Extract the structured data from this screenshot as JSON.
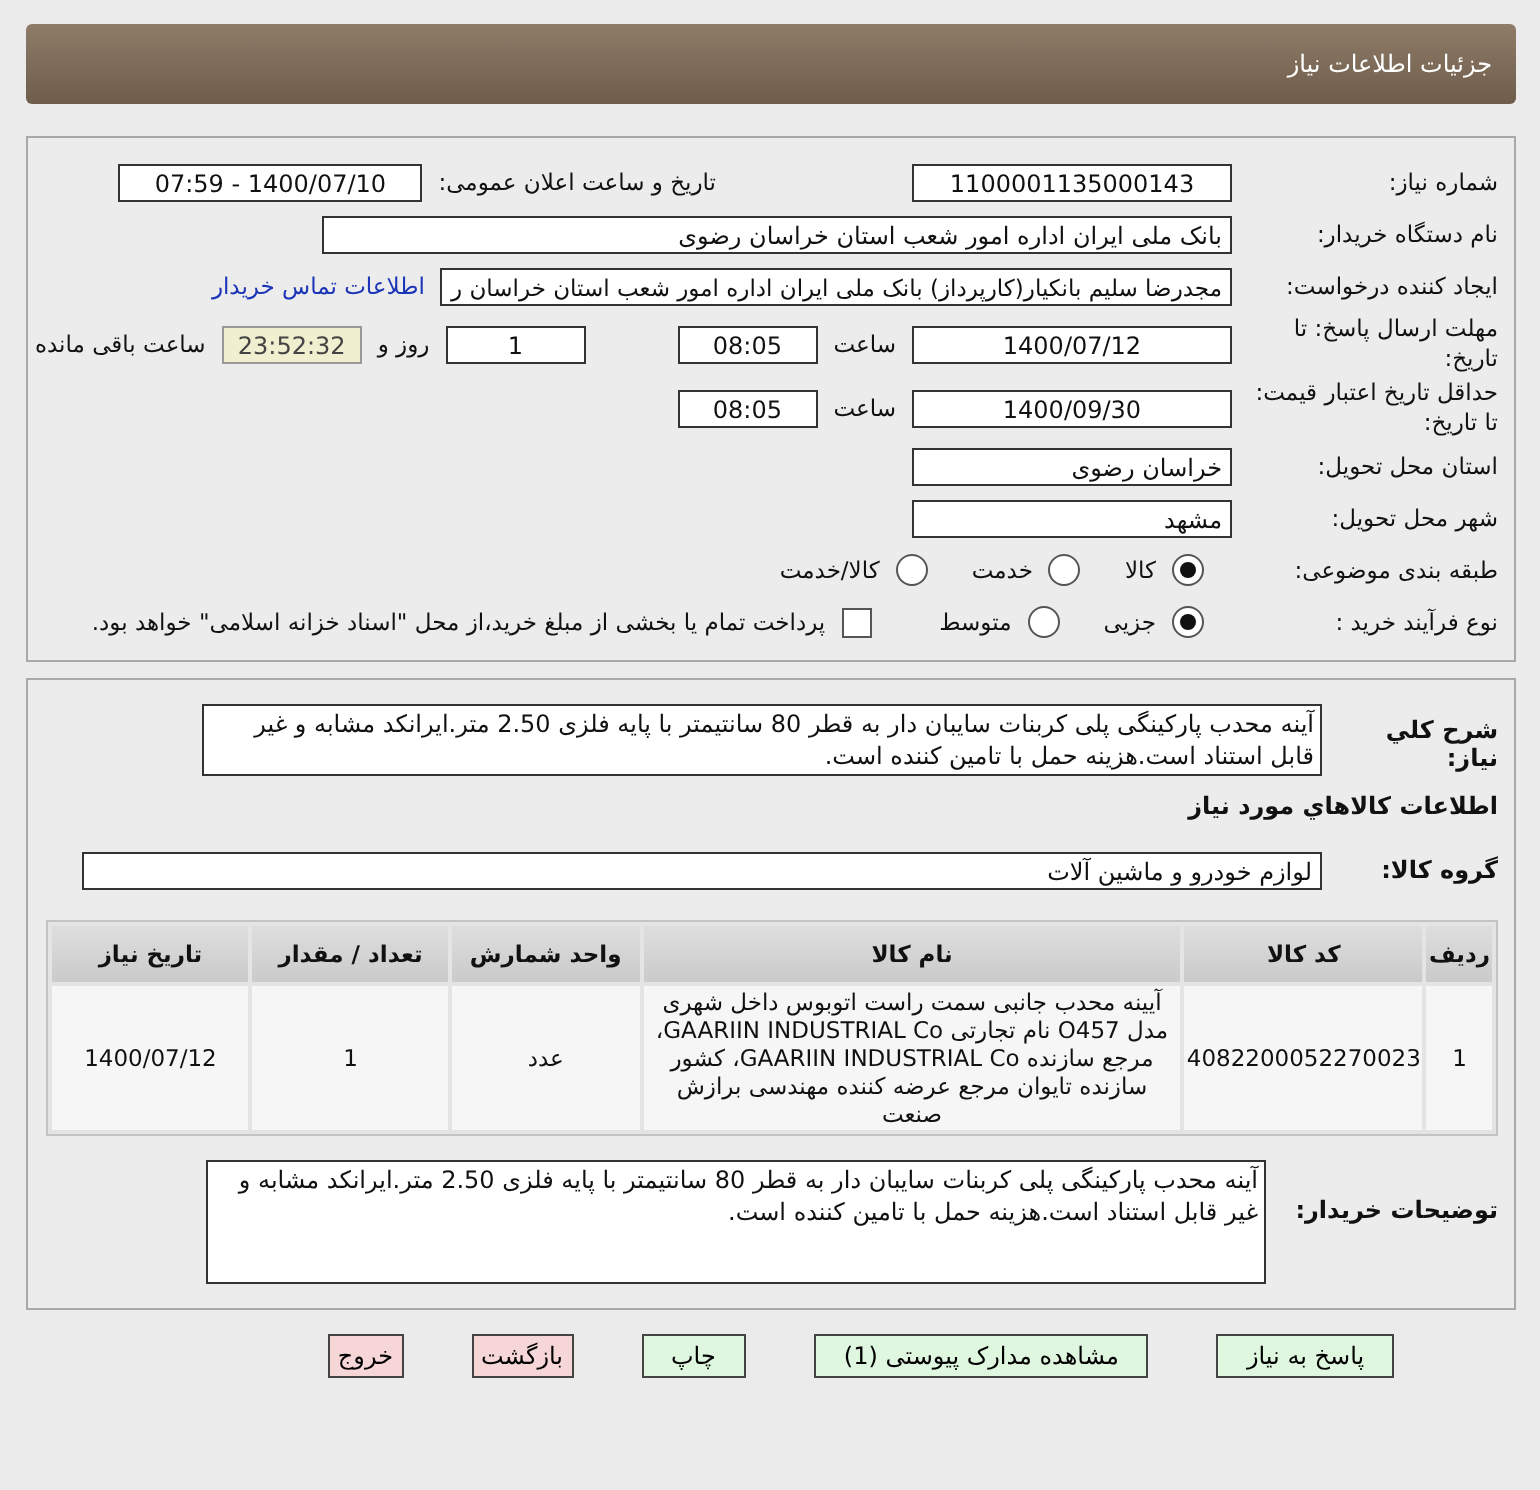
{
  "header": {
    "title": "جزئیات اطلاعات نیاز"
  },
  "info": {
    "need_number": {
      "label": "شماره نیاز:",
      "value": "1100001135000143"
    },
    "announce": {
      "label": "تاریخ و ساعت اعلان عمومی:",
      "value": "1400/07/10 - 07:59"
    },
    "buyer_org": {
      "label": "نام دستگاه خریدار:",
      "value": "بانک ملی ایران اداره امور شعب استان خراسان رضوی"
    },
    "requester": {
      "label": "ایجاد کننده درخواست:",
      "value": "مجدرضا سلیم  بانکیار(کارپرداز) بانک ملی ایران اداره امور شعب استان خراسان ر",
      "link": "اطلاعات تماس خریدار"
    },
    "reply_deadline": {
      "label": "مهلت ارسال پاسخ: تا تاریخ:",
      "date": "1400/07/12",
      "time_label": "ساعت",
      "time": "08:05",
      "days": "1",
      "days_label": "روز و",
      "remaining": "23:52:32",
      "remaining_label": "ساعت باقی مانده"
    },
    "validity": {
      "label": "حداقل تاریخ اعتبار قیمت: تا تاریخ:",
      "date": "1400/09/30",
      "time_label": "ساعت",
      "time": "08:05"
    },
    "province": {
      "label": "استان محل تحویل:",
      "value": "خراسان رضوی"
    },
    "city": {
      "label": "شهر محل تحویل:",
      "value": "مشهد"
    },
    "category": {
      "label": "طبقه بندی موضوعی:",
      "options": [
        {
          "label": "کالا",
          "selected": true
        },
        {
          "label": "خدمت",
          "selected": false
        },
        {
          "label": "کالا/خدمت",
          "selected": false
        }
      ]
    },
    "process": {
      "label": "نوع فرآیند خرید :",
      "options": [
        {
          "kind": "radio",
          "label": "جزیی",
          "selected": true
        },
        {
          "kind": "radio",
          "label": "متوسط",
          "selected": false
        },
        {
          "kind": "checkbox",
          "label": "پرداخت تمام یا بخشی از مبلغ خرید،از محل \"اسناد خزانه اسلامی\" خواهد بود.",
          "checked": false
        }
      ]
    }
  },
  "description": {
    "label": "شرح کلي نياز:",
    "text": "آینه محدب پارکینگی پلی کربنات سایبان دار به قطر 80 سانتیمتر با پایه فلزی 2.50 متر.ایرانکد مشابه و غیر قابل استناد است.هزینه حمل با تامین کننده است."
  },
  "items_title": "اطلاعات کالاهاي مورد نياز",
  "group": {
    "label": "گروه کالا:",
    "value": "لوازم خودرو و ماشین آلات"
  },
  "table": {
    "columns": [
      "ردیف",
      "کد کالا",
      "نام کالا",
      "واحد شمارش",
      "تعداد / مقدار",
      "تاریخ نیاز"
    ],
    "rows": [
      [
        "1",
        "4082200052270023",
        "آیینه محدب جانبی سمت راست اتوبوس داخل شهری مدل O457 نام تجارتی GAARIIN INDUSTRIAL Co، مرجع سازنده GAARIIN INDUSTRIAL Co، کشور سازنده تایوان مرجع عرضه کننده مهندسی برازش صنعت",
        "عدد",
        "1",
        "1400/07/12"
      ]
    ]
  },
  "notes": {
    "label": "توضیحات خریدار:",
    "text": "آینه محدب پارکینگی پلی کربنات سایبان دار به قطر 80 سانتیمتر با پایه فلزی 2.50 متر.ایرانکد مشابه و غیر قابل استناد است.هزینه حمل با تامین کننده است."
  },
  "buttons": [
    {
      "label": "پاسخ به نیاز",
      "kind": "normal"
    },
    {
      "label": "مشاهده مدارک پیوستی (1)",
      "kind": "normal"
    },
    {
      "label": "چاپ",
      "kind": "normal"
    },
    {
      "label": "بازگشت",
      "kind": "danger"
    },
    {
      "label": "خروج",
      "kind": "danger"
    }
  ]
}
